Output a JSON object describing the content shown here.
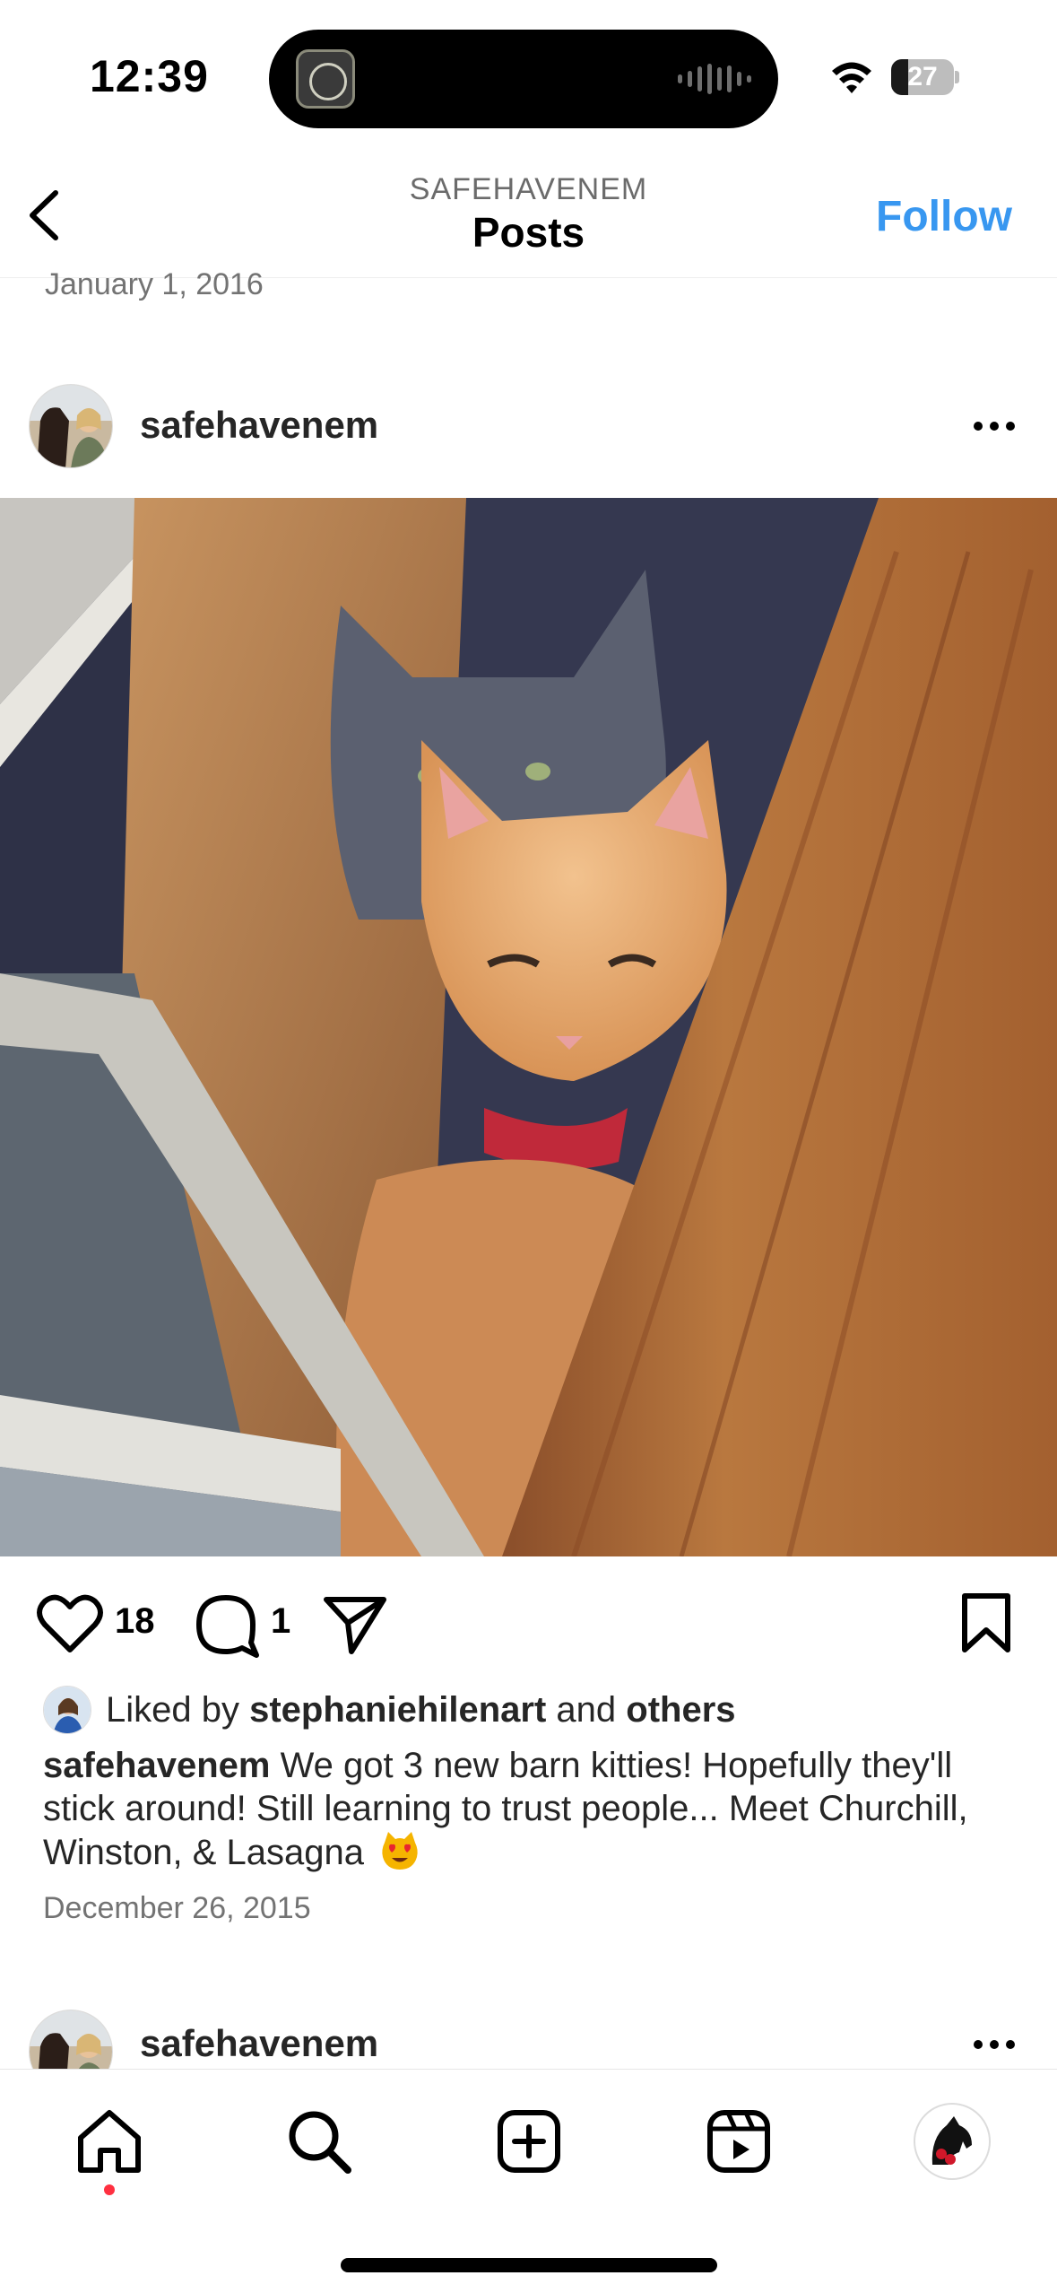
{
  "status_bar": {
    "time": "12:39",
    "battery": "27",
    "battery_level_percent": 27
  },
  "nav": {
    "account": "SAFEHAVENEM",
    "title": "Posts",
    "follow_label": "Follow",
    "back_icon": "chevron-left-icon"
  },
  "previous_post": {
    "date": "January 1, 2016"
  },
  "post": {
    "username": "safehavenem",
    "likes_count": "18",
    "comments_count": "1",
    "liked_by_prefix": "Liked by ",
    "liked_by_user": "stephaniehilenart",
    "liked_by_and": " and ",
    "liked_by_others": "others",
    "caption_user": "safehavenem",
    "caption_text": "We got 3 new barn kitties! Hopefully they'll stick around! Still learning to trust people... Meet Churchill, Winston, & Lasagna",
    "caption_emoji": "heart-eyes-cat-emoji",
    "date": "December 26, 2015"
  },
  "next_post": {
    "username": "safehavenem"
  },
  "tab_bar": {
    "items": [
      "home-icon",
      "search-icon",
      "create-icon",
      "reels-icon",
      "profile-avatar"
    ],
    "active": "home-icon"
  },
  "colors": {
    "follow": "#3897f0",
    "notification_dot": "#ff3040"
  }
}
